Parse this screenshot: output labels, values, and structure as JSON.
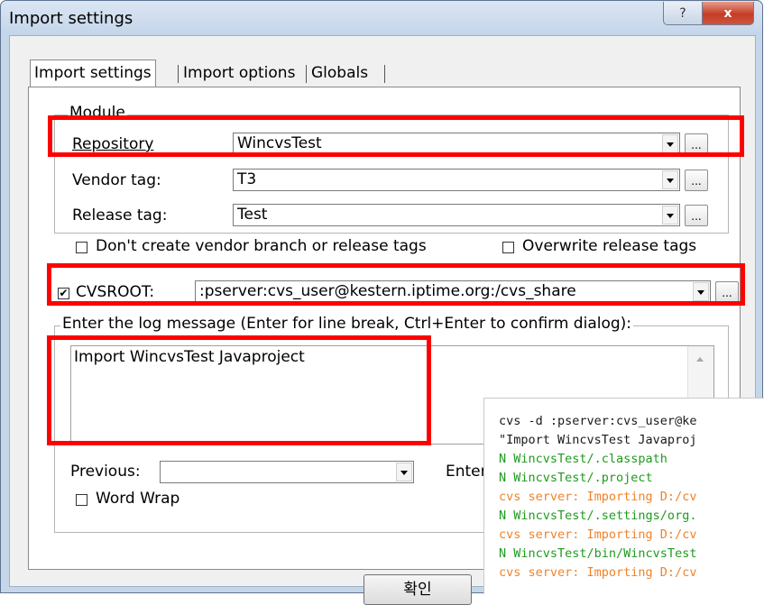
{
  "window": {
    "title": "Import settings"
  },
  "titlebar": {
    "help_glyph": "?",
    "close_glyph": "x"
  },
  "tabs": [
    {
      "label": "Import settings",
      "active": true
    },
    {
      "label": "Import options",
      "active": false
    },
    {
      "label": "Globals",
      "active": false
    }
  ],
  "module": {
    "legend": "Module",
    "repository": {
      "label": "Repository",
      "value": "WincvsTest"
    },
    "vendor_tag": {
      "label": "Vendor tag:",
      "value": "T3"
    },
    "release_tag": {
      "label": "Release tag:",
      "value": "Test"
    },
    "dont_create_tags": {
      "label": "Don't create vendor branch or release tags",
      "checked": false
    },
    "overwrite_release": {
      "label": "Overwrite release tags",
      "checked": false
    }
  },
  "cvsroot": {
    "label": "CVSROOT:",
    "checked": true,
    "check_glyph": "✔",
    "value": ":pserver:cvs_user@kestern.iptime.org:/cvs_share"
  },
  "browse_label": "...",
  "log": {
    "legend": "Enter the log message (Enter for line break, Ctrl+Enter to confirm dialog):",
    "message": "Import WincvsTest Javaproject",
    "previous_label": "Previous:",
    "previous_value": "",
    "enter_label": "Enter",
    "word_wrap": {
      "label": "Word Wrap",
      "checked": false
    }
  },
  "buttons": {
    "ok": "확인"
  },
  "console": {
    "colors": {
      "default": "#1a1a1a",
      "green": "#1e9b1e",
      "orange": "#f0822a"
    },
    "lines": [
      {
        "text": "cvs -d :pserver:cvs_user@ke",
        "color": "default"
      },
      {
        "text": "\"Import WincvsTest Javaproj",
        "color": "default"
      },
      {
        "text": "N WincvsTest/.classpath",
        "color": "green"
      },
      {
        "text": "N WincvsTest/.project",
        "color": "green"
      },
      {
        "text": "cvs server: Importing D:/cv",
        "color": "orange"
      },
      {
        "text": "N WincvsTest/.settings/org.",
        "color": "green"
      },
      {
        "text": "cvs server: Importing D:/cv",
        "color": "orange"
      },
      {
        "text": "N WincvsTest/bin/WincvsTest",
        "color": "green"
      },
      {
        "text": "cvs server: Importing D:/cv",
        "color": "orange"
      }
    ]
  },
  "annotation_color": "#ff0000"
}
